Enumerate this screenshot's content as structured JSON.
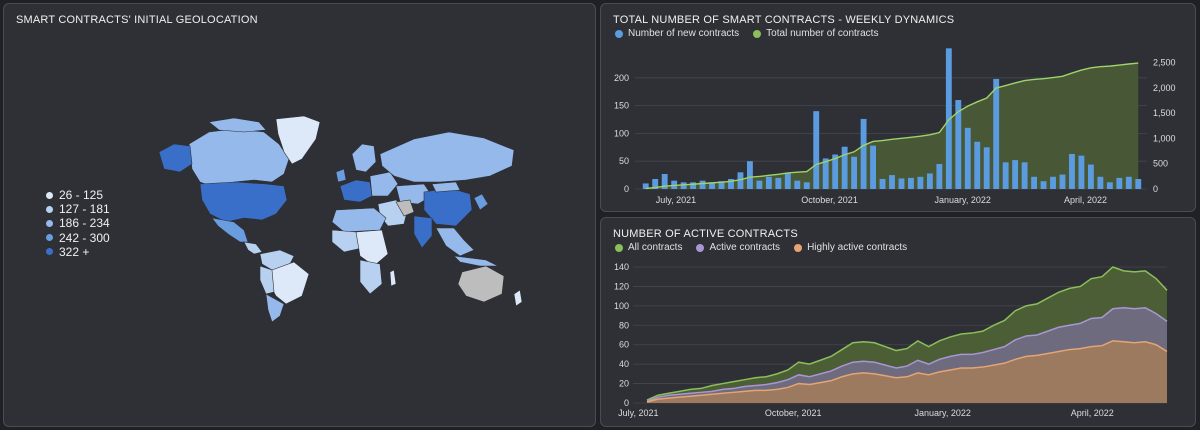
{
  "geo": {
    "title": "SMART CONTRACTS' INITIAL GEOLOCATION",
    "legend": [
      {
        "label": "26 - 125",
        "color": "#dde9f8"
      },
      {
        "label": "127 - 181",
        "color": "#b9d1f1"
      },
      {
        "label": "186 - 234",
        "color": "#94b9ea"
      },
      {
        "label": "242 - 300",
        "color": "#6a9ce0"
      },
      {
        "label": "322 +",
        "color": "#3a6fc9"
      }
    ],
    "no_data_color": "#bdbdbd"
  },
  "weekly": {
    "title": "TOTAL NUMBER OF SMART CONTRACTS - WEEKLY DYNAMICS",
    "legend": [
      {
        "label": "Number of new contracts",
        "color": "#5b9be0"
      },
      {
        "label": "Total number of contracts",
        "color": "#8cbf5a"
      }
    ]
  },
  "active": {
    "title": "NUMBER OF ACTIVE CONTRACTS",
    "legend": [
      {
        "label": "All contracts",
        "color": "#8cbf5a"
      },
      {
        "label": "Active contracts",
        "color": "#a996d4"
      },
      {
        "label": "Highly active contracts",
        "color": "#e6a474"
      }
    ]
  },
  "chart_data": [
    {
      "type": "bar",
      "title": "TOTAL NUMBER OF SMART CONTRACTS - WEEKLY DYNAMICS",
      "x_tick_labels": [
        "July, 2021",
        "October, 2021",
        "January, 2022",
        "April, 2022"
      ],
      "y_left_ticks": [
        0,
        50,
        100,
        150,
        200
      ],
      "y_left_range": [
        0,
        250
      ],
      "y_right_ticks": [
        "0",
        "500",
        "1,000",
        "1,500",
        "2,000",
        "2,500"
      ],
      "y_right_range": [
        0,
        2750
      ],
      "grid": true,
      "legend_position": "top-left",
      "series": [
        {
          "name": "Number of new contracts",
          "color": "#5b9be0",
          "values": [
            10,
            18,
            27,
            15,
            12,
            12,
            15,
            12,
            14,
            18,
            30,
            50,
            15,
            22,
            20,
            28,
            15,
            12,
            140,
            55,
            62,
            76,
            58,
            126,
            78,
            18,
            25,
            19,
            20,
            22,
            28,
            45,
            253,
            160,
            110,
            85,
            75,
            198,
            48,
            52,
            48,
            22,
            14,
            22,
            26,
            63,
            60,
            44,
            22,
            12,
            20,
            22,
            18
          ]
        },
        {
          "name": "Total number of contracts",
          "color": "#8cbf5a",
          "values": [
            10,
            28,
            55,
            70,
            82,
            94,
            109,
            121,
            135,
            153,
            183,
            233,
            248,
            270,
            290,
            318,
            333,
            345,
            485,
            540,
            602,
            678,
            736,
            862,
            940,
            958,
            983,
            1002,
            1022,
            1044,
            1072,
            1117,
            1370,
            1530,
            1640,
            1725,
            1800,
            1998,
            2046,
            2098,
            2146,
            2168,
            2182,
            2204,
            2230,
            2293,
            2353,
            2397,
            2419,
            2431,
            2451,
            2473,
            2491
          ]
        }
      ]
    },
    {
      "type": "area",
      "title": "NUMBER OF ACTIVE CONTRACTS",
      "x_tick_labels": [
        "July, 2021",
        "October, 2021",
        "January, 2022",
        "April, 2022"
      ],
      "y_ticks": [
        0,
        20,
        40,
        60,
        80,
        100,
        120,
        140
      ],
      "ylim": [
        0,
        140
      ],
      "grid": true,
      "legend_position": "top-left",
      "series": [
        {
          "name": "All contracts",
          "color": "#8cbf5a",
          "values": [
            3,
            8,
            10,
            12,
            14,
            15,
            18,
            20,
            22,
            24,
            26,
            27,
            30,
            34,
            42,
            40,
            44,
            48,
            55,
            62,
            63,
            62,
            58,
            54,
            56,
            64,
            58,
            64,
            68,
            71,
            72,
            74,
            80,
            85,
            95,
            100,
            102,
            108,
            114,
            118,
            120,
            128,
            130,
            140,
            136,
            135,
            136,
            128,
            116
          ]
        },
        {
          "name": "Active contracts",
          "color": "#a996d4",
          "values": [
            2,
            6,
            8,
            9,
            10,
            11,
            12,
            14,
            15,
            17,
            18,
            19,
            21,
            24,
            29,
            27,
            30,
            33,
            38,
            42,
            43,
            42,
            39,
            36,
            38,
            44,
            40,
            45,
            48,
            50,
            50,
            52,
            55,
            58,
            65,
            69,
            70,
            74,
            78,
            80,
            82,
            87,
            88,
            97,
            98,
            97,
            98,
            92,
            84
          ]
        },
        {
          "name": "Highly active contracts",
          "color": "#e6a474",
          "values": [
            1,
            4,
            5,
            6,
            7,
            8,
            9,
            10,
            11,
            12,
            13,
            13,
            14,
            16,
            20,
            19,
            21,
            23,
            27,
            30,
            31,
            30,
            28,
            26,
            27,
            31,
            29,
            32,
            34,
            36,
            36,
            37,
            39,
            41,
            45,
            48,
            49,
            51,
            53,
            55,
            56,
            58,
            59,
            64,
            63,
            62,
            63,
            60,
            53
          ]
        }
      ]
    }
  ]
}
